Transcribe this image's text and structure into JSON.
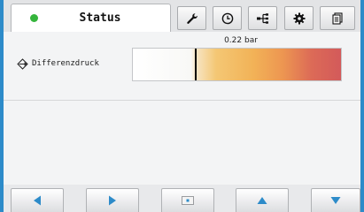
{
  "tabs": {
    "status_label": "Status",
    "status_indicator_color": "#35b53c",
    "icons": [
      "wrench-icon",
      "clock-icon",
      "network-tree-icon",
      "gear-icon",
      "document-icon"
    ]
  },
  "sensor": {
    "label": "Differenzdruck",
    "value_text": "0.22 bar",
    "gauge_fraction": 0.3
  },
  "nav": {
    "icons": [
      "arrow-left-icon",
      "arrow-right-icon",
      "center-dot-icon",
      "arrow-up-icon",
      "arrow-down-icon"
    ]
  },
  "colors": {
    "frame": "#2d8bc9",
    "arrow": "#2d8bc9",
    "indicator": "#35b53c",
    "gauge_orange": "#f2b257",
    "gauge_red": "#d35a5a"
  }
}
